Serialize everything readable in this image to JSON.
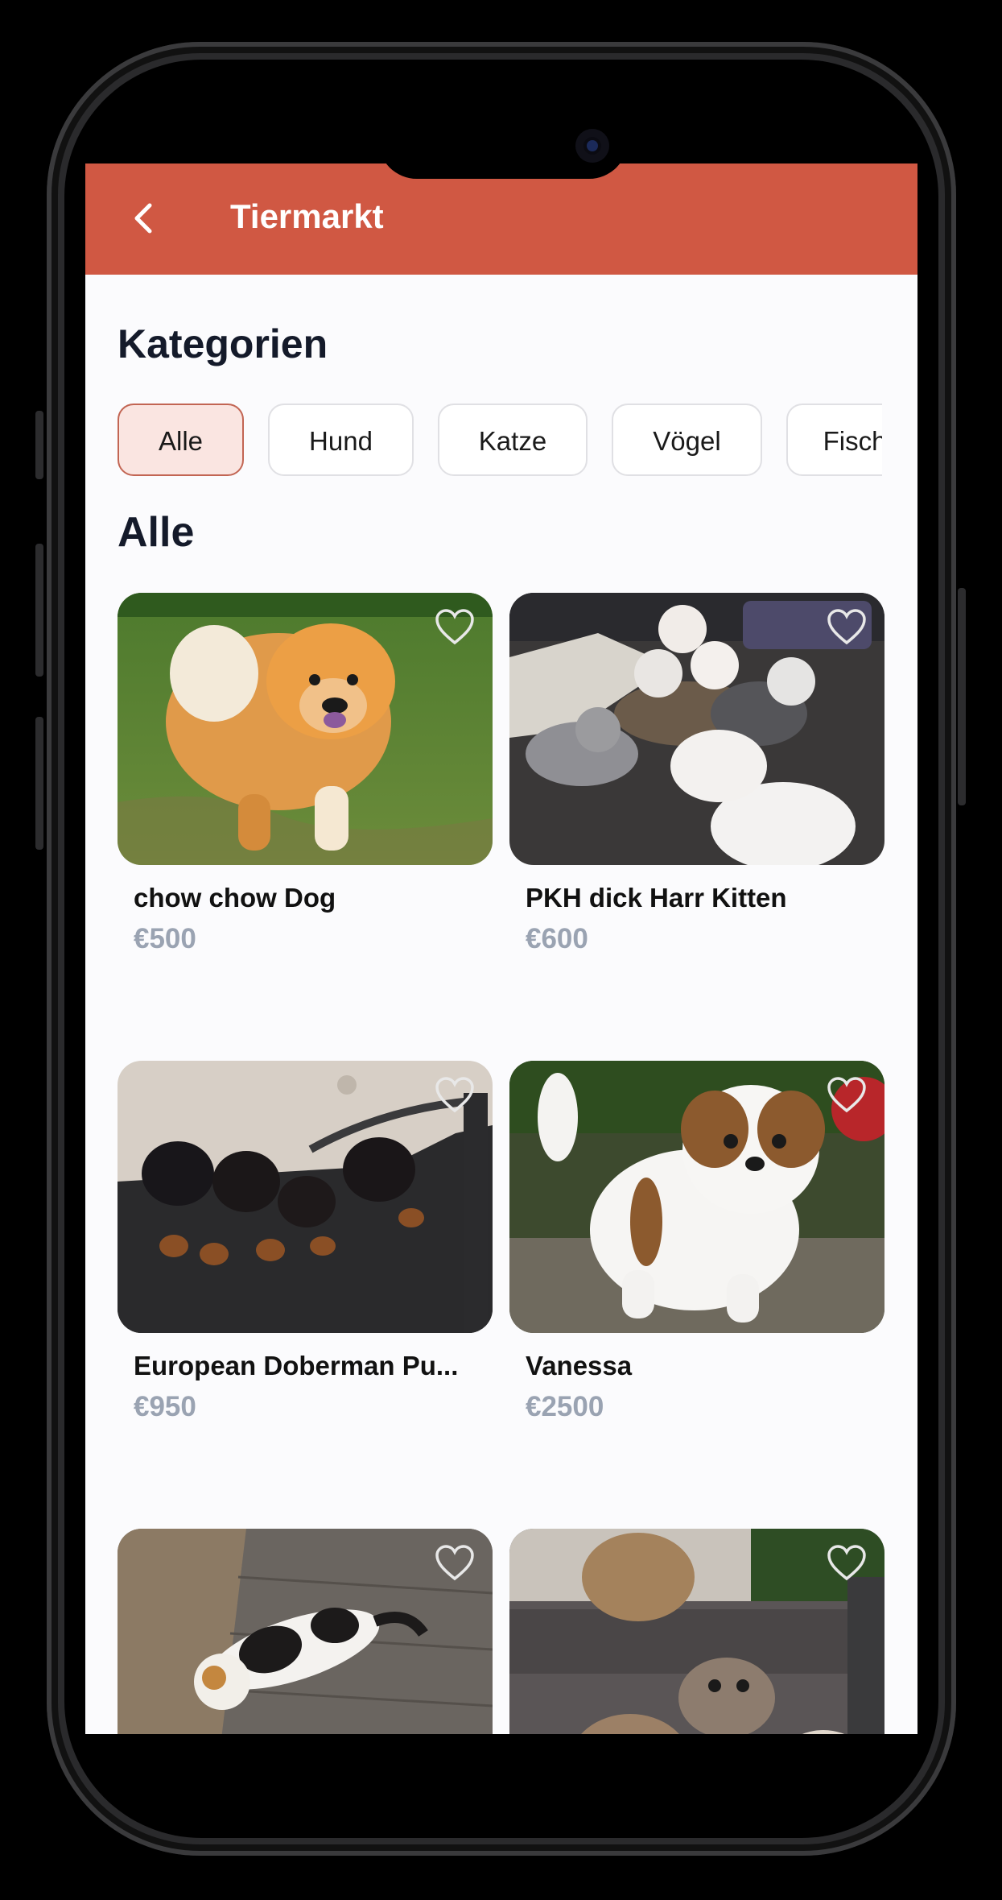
{
  "appbar": {
    "title": "Tiermarkt",
    "back_icon": "chevron-left-icon",
    "background": "#d05843"
  },
  "categories_heading": "Kategorien",
  "categories": [
    {
      "label": "Alle",
      "active": true
    },
    {
      "label": "Hund",
      "active": false
    },
    {
      "label": "Katze",
      "active": false
    },
    {
      "label": "Vögel",
      "active": false
    },
    {
      "label": "Fisch",
      "active": false
    }
  ],
  "listing_heading": "Alle",
  "listings": [
    {
      "name": "chow chow Dog",
      "price": "€500",
      "photo": "chow-chow-dog-photo",
      "favorite_icon": "heart-outline-icon"
    },
    {
      "name": "PKH dick Harr Kitten",
      "price": "€600",
      "photo": "kittens-photo",
      "favorite_icon": "heart-outline-icon"
    },
    {
      "name": "European Doberman Pu...",
      "price": "€950",
      "photo": "doberman-puppies-photo",
      "favorite_icon": "heart-outline-icon"
    },
    {
      "name": "Vanessa",
      "price": "€2500",
      "photo": "shih-tzu-puppy-photo",
      "favorite_icon": "heart-outline-icon"
    },
    {
      "name": "",
      "price": "",
      "photo": "calico-cat-photo",
      "favorite_icon": "heart-outline-icon"
    },
    {
      "name": "",
      "price": "",
      "photo": "persian-kittens-photo",
      "favorite_icon": "heart-outline-icon"
    }
  ],
  "colors": {
    "accent": "#d05843",
    "chip_active_bg": "#fae5e1",
    "chip_active_border": "#c26553",
    "price": "#9aa3b2",
    "heading": "#141a2a"
  }
}
